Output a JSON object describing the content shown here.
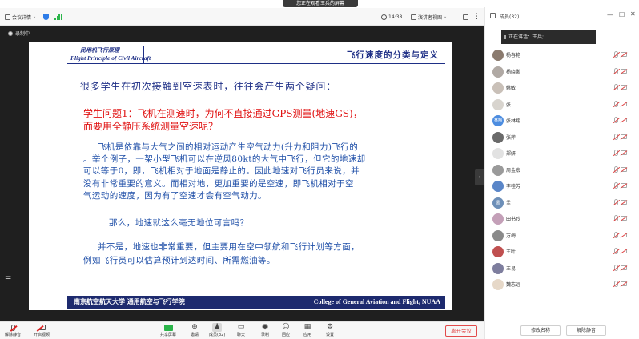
{
  "banner": {
    "text": "您正在观看王兵的屏幕"
  },
  "topbar": {
    "meeting_info": "会议详情",
    "time": "14:38",
    "view_mode": "演讲者视图",
    "members_label": "成员(32)"
  },
  "stage": {
    "recording": "录制中"
  },
  "slide": {
    "brand_cn": "民用机飞行原理",
    "brand_en": "Flight Principle of Civil Aircraft",
    "title": "飞行速度的分类与定义",
    "intro": "很多学生在初次接触到空速表时，往往会产生两个疑问：",
    "question_line1": "学生问题1：飞机在测速时，为何不直接通过GPS测量(地速GS)，",
    "question_line2": "而要用全静压系统测量空速呢？",
    "body_lines": [
      "飞机是依靠与大气之间的相对运动产生空气动力(升力和阻力)飞行的",
      "。举个例子，一架小型飞机可以在逆风80kt的大气中飞行，但它的地速却",
      "可以等于0，即，飞机相对于地面是静止的。因此地速对飞行员来说，并",
      "没有非常重要的意义。而相对地，更加重要的是空速，即飞机相对于空",
      "气运动的速度，因为有了空速才会有空气动力。",
      "那么，地速就这么毫无地位可言吗？",
      "并不是，地速也非常重要，但主要用在空中领航和飞行计划等方面，",
      "例如飞行员可以估算预计到达时间、所需燃油等。"
    ],
    "footer_cn": "南京航空航天大学  通用航空与飞行学院",
    "footer_en": "College of General Aviation and Flight, NUAA"
  },
  "bottombar": {
    "unmute": "解除静音",
    "video": "开启视频",
    "share": "共享屏幕",
    "invite": "邀请",
    "members": "成员(32)",
    "chat": "聊天",
    "record": "录制",
    "reactions": "回应",
    "apps": "应用",
    "settings": "设置",
    "leave": "离开会议"
  },
  "panel": {
    "speaking": "正在讲话：王兵;",
    "members": [
      {
        "name": "杨春艳",
        "avatar_text": "",
        "color": "#8a7a6e"
      },
      {
        "name": "杨晓鹏",
        "avatar_text": "",
        "color": "#b0a9a4"
      },
      {
        "name": "姚敏",
        "avatar_text": "",
        "color": "#c9c0b8"
      },
      {
        "name": "张",
        "avatar_text": "",
        "color": "#d8d4ce"
      },
      {
        "name": "张林翔",
        "avatar_text": "林翔",
        "color": "#4d8de0"
      },
      {
        "name": "张萍",
        "avatar_text": "",
        "color": "#6a6a6a"
      },
      {
        "name": "郑妍",
        "avatar_text": "",
        "color": "#e2e2e2"
      },
      {
        "name": "周金宏",
        "avatar_text": "",
        "color": "#9a9a9a"
      },
      {
        "name": "李桂芳",
        "avatar_text": "",
        "color": "#5a86c8"
      },
      {
        "name": "孟",
        "avatar_text": "孟",
        "color": "#6d8fb8"
      },
      {
        "name": "田书玲",
        "avatar_text": "",
        "color": "#c4a0b8"
      },
      {
        "name": "万梅",
        "avatar_text": "",
        "color": "#8a8a8a"
      },
      {
        "name": "王叶",
        "avatar_text": "",
        "color": "#c05050"
      },
      {
        "name": "王易",
        "avatar_text": "",
        "color": "#7e7e9e"
      },
      {
        "name": "魏志远",
        "avatar_text": "",
        "color": "#e6d8c8"
      }
    ],
    "rename_button": "修改名称",
    "unmute_button": "解除静音"
  }
}
